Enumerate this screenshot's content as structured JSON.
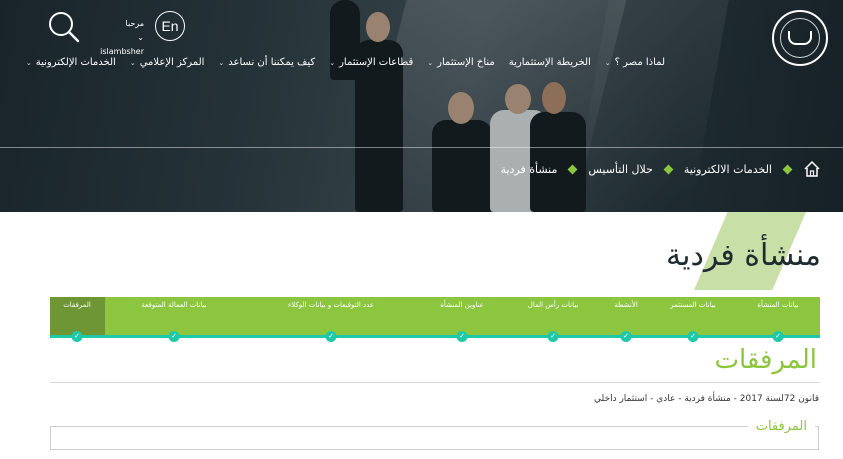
{
  "header": {
    "greeting": "مرحبا",
    "username": "islambsher",
    "lang_button": "En",
    "nav": [
      {
        "label": "لماذا مصر ؟"
      },
      {
        "label": "الخريطة الإستثمارية"
      },
      {
        "label": "مناخ الإستثمار"
      },
      {
        "label": "قطاعات الإستثمار"
      },
      {
        "label": "كيف يمكننا أن نساعد"
      },
      {
        "label": "المركز الإعلامي"
      },
      {
        "label": "الخدمات الإلكترونية"
      }
    ]
  },
  "breadcrumb": {
    "items": [
      "الخدمات الالكترونية",
      "حلال التأسيس",
      "منشأة فردية"
    ]
  },
  "page": {
    "title": "منشأة فردية"
  },
  "steps": {
    "items": [
      {
        "label": "بيانات المنشأة"
      },
      {
        "label": "بيانات المستثمر"
      },
      {
        "label": "الأنشطة"
      },
      {
        "label": "بيانات رأس المال"
      },
      {
        "label": "عناوين المنشأة"
      },
      {
        "label": "عدد التوقيعات و بيانات الوكلاء"
      },
      {
        "label": "بيانات العمالة المتوقعة"
      },
      {
        "label": "المرفقات"
      }
    ],
    "active_index": 7
  },
  "attachments": {
    "title": "المرفقات",
    "info": "قانون 72لسنة 2017 - منشأة فردية - عادي - استثمار داخلي",
    "box_legend": "المرفقات"
  },
  "colors": {
    "accent_green": "#8cc63f",
    "teal": "#1fc8a9"
  },
  "icons": {
    "search": "search-icon",
    "home": "home-icon",
    "logo": "gafi-logo"
  }
}
